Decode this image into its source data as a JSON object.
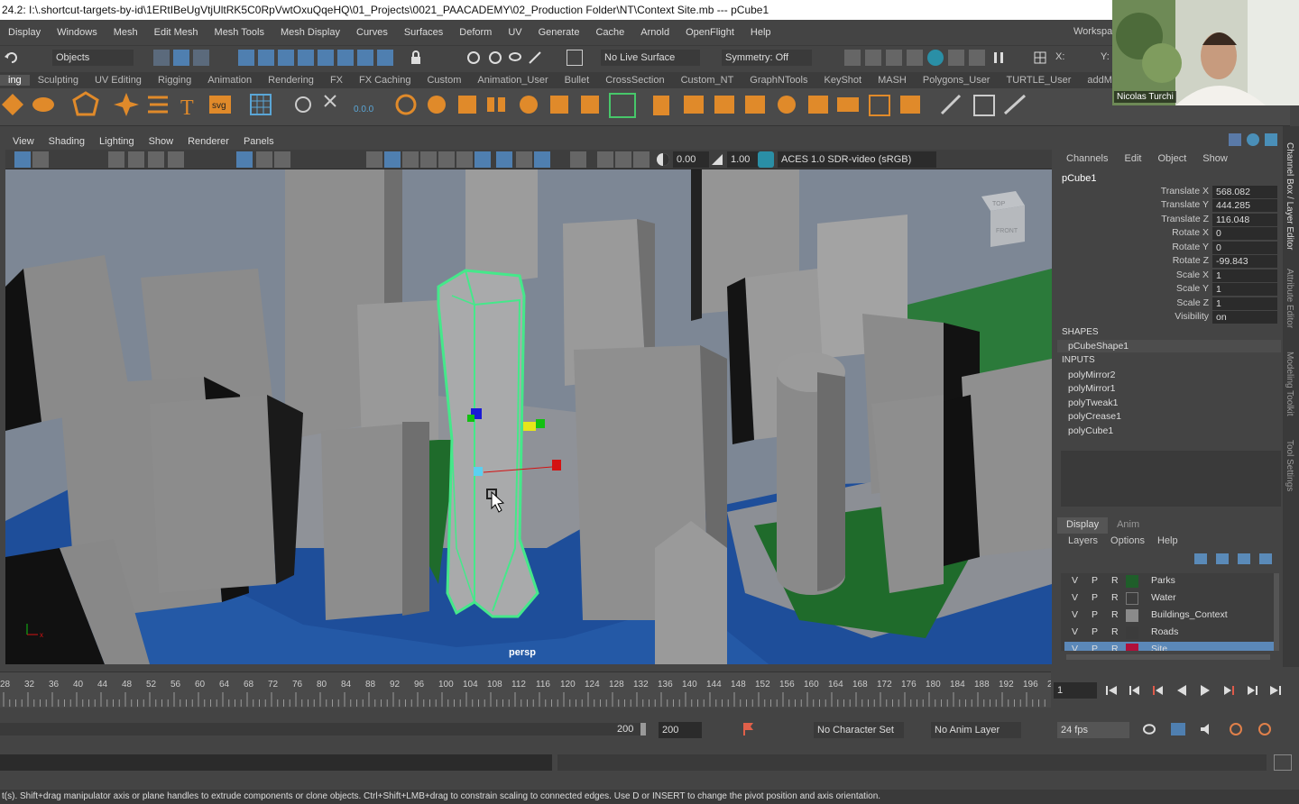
{
  "title": "24.2: I:\\.shortcut-targets-by-id\\1ERtIBeUgVtjUltRK5C0RpVwtOxuQqeHQ\\01_Projects\\0021_PAACADEMY\\02_Production Folder\\NT\\Context Site.mb   ---   pCube1",
  "menu": [
    "Display",
    "Windows",
    "Mesh",
    "Edit Mesh",
    "Mesh Tools",
    "Mesh Display",
    "Curves",
    "Surfaces",
    "Deform",
    "UV",
    "Generate",
    "Cache",
    "Arnold",
    "OpenFlight",
    "Help"
  ],
  "workspace_label": "Workspac",
  "toolbar": {
    "mode": "Objects",
    "live_surface": "No Live Surface",
    "symmetry": "Symmetry: Off",
    "x_label": "X:",
    "y_label": "Y:"
  },
  "shelf_tabs": [
    "ing",
    "Sculpting",
    "UV Editing",
    "Rigging",
    "Animation",
    "Rendering",
    "FX",
    "FX Caching",
    "Custom",
    "Animation_User",
    "Bullet",
    "CrossSection",
    "Custom_NT",
    "GraphNTools",
    "KeyShot",
    "MASH",
    "Polygons_User",
    "TURTLE_User",
    "addMa"
  ],
  "viewport": {
    "menu": [
      "View",
      "Shading",
      "Lighting",
      "Show",
      "Renderer",
      "Panels"
    ],
    "exposure": "0.00",
    "gamma": "1.00",
    "color_space": "ACES 1.0 SDR-video (sRGB)",
    "camera_label": "persp",
    "cube_top": "TOP",
    "cube_front": "FRONT"
  },
  "channel_box": {
    "menu": [
      "Channels",
      "Edit",
      "Object",
      "Show"
    ],
    "object": "pCube1",
    "attrs": [
      {
        "label": "Translate X",
        "value": "568.082"
      },
      {
        "label": "Translate Y",
        "value": "444.285"
      },
      {
        "label": "Translate Z",
        "value": "116.048"
      },
      {
        "label": "Rotate X",
        "value": "0"
      },
      {
        "label": "Rotate Y",
        "value": "0"
      },
      {
        "label": "Rotate Z",
        "value": "-99.843"
      },
      {
        "label": "Scale X",
        "value": "1"
      },
      {
        "label": "Scale Y",
        "value": "1"
      },
      {
        "label": "Scale Z",
        "value": "1"
      },
      {
        "label": "Visibility",
        "value": "on"
      }
    ],
    "shapes_heading": "SHAPES",
    "shape": "pCubeShape1",
    "inputs_heading": "INPUTS",
    "inputs": [
      "polyMirror2",
      "polyMirror1",
      "polyTweak1",
      "polyCrease1",
      "polyCube1"
    ]
  },
  "layer_editor": {
    "tabs": [
      "Display",
      "Anim"
    ],
    "menu": [
      "Layers",
      "Options",
      "Help"
    ],
    "layers": [
      {
        "v": "V",
        "p": "P",
        "r": "R",
        "name": "Parks",
        "color": "#1f5e2a"
      },
      {
        "v": "V",
        "p": "P",
        "r": "R",
        "name": "Water",
        "color": "#3c3c3c"
      },
      {
        "v": "V",
        "p": "P",
        "r": "R",
        "name": "Buildings_Context",
        "color": "#8a8a8a"
      },
      {
        "v": "V",
        "p": "P",
        "r": "R",
        "name": "Roads",
        "color": "#3c3c3c"
      },
      {
        "v": "V",
        "p": "P",
        "r": "R",
        "name": "Site",
        "color": "#b0103a"
      }
    ]
  },
  "side_tabs": [
    "Channel Box / Layer Editor",
    "Attribute Editor",
    "Modeling Toolkit",
    "Tool Settings"
  ],
  "timeline": {
    "ticks": [
      "28",
      "32",
      "36",
      "40",
      "44",
      "48",
      "52",
      "56",
      "60",
      "64",
      "68",
      "72",
      "76",
      "80",
      "84",
      "88",
      "92",
      "96",
      "100",
      "104",
      "108",
      "112",
      "116",
      "120",
      "124",
      "128",
      "132",
      "136",
      "140",
      "144",
      "148",
      "152",
      "156",
      "160",
      "164",
      "168",
      "172",
      "176",
      "180",
      "184",
      "188",
      "192",
      "196",
      "20"
    ],
    "current_frame": "1"
  },
  "range": {
    "end_a": "200",
    "end_b": "200",
    "character_set": "No Character Set",
    "anim_layer": "No Anim Layer",
    "fps": "24 fps"
  },
  "webcam_name": "Nicolas Turchi",
  "help_line": "t(s). Shift+drag manipulator axis or plane handles to extrude components or clone objects. Ctrl+Shift+LMB+drag to constrain scaling to connected edges. Use D or INSERT to change the pivot position and axis orientation."
}
